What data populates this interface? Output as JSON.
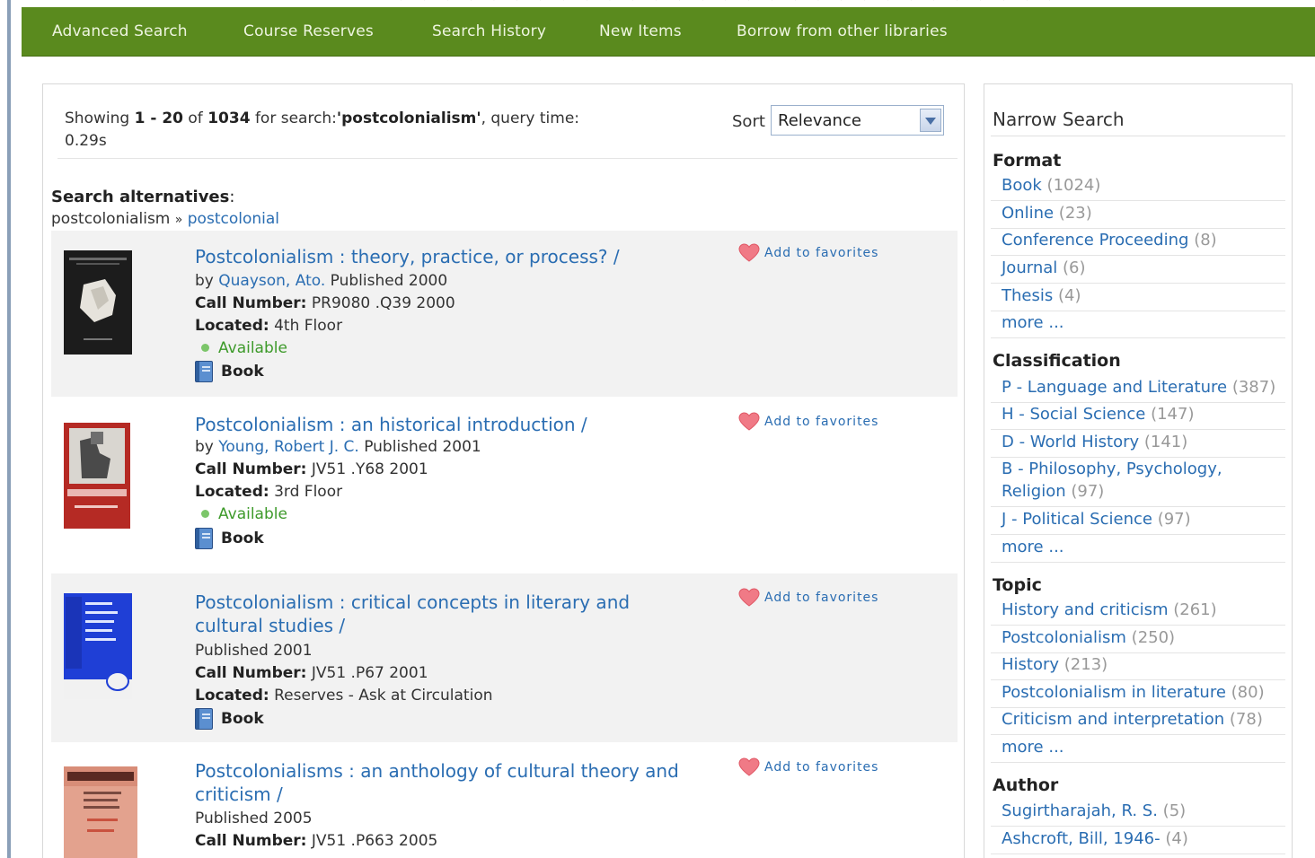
{
  "nav": {
    "items": [
      "Advanced Search",
      "Course Reserves",
      "Search History",
      "New Items",
      "Borrow from other libraries"
    ]
  },
  "header": {
    "showing_label": "Showing",
    "range_start": "1",
    "range_sep": " - ",
    "range_end": "20",
    "of_label": "of",
    "total": "1034",
    "for_search_label": "for search:",
    "query": "'postcolonialism'",
    "query_time_label": ", query time:",
    "query_time": "0.29s"
  },
  "sort": {
    "label": "Sort",
    "selected": "Relevance"
  },
  "alternatives": {
    "title": "Search alternatives",
    "colon": ":",
    "from": "postcolonialism",
    "sep": "»",
    "to": "postcolonial"
  },
  "labels": {
    "by": "by",
    "call_number": "Call Number",
    "located": "Located",
    "colon": ":",
    "add_favorites": "Add to favorites"
  },
  "records": [
    {
      "title": "Postcolonialism : theory, practice, or process? /",
      "author": "Quayson, Ato.",
      "published": "Published 2000",
      "call_number": "PR9080 .Q39 2000",
      "location": "4th Floor",
      "status": "Available",
      "format": "Book"
    },
    {
      "title": "Postcolonialism : an historical introduction /",
      "author": "Young, Robert J. C.",
      "published": "Published 2001",
      "call_number": "JV51 .Y68 2001",
      "location": "3rd Floor",
      "status": "Available",
      "format": "Book"
    },
    {
      "title": "Postcolonialism : critical concepts in literary and cultural studies /",
      "published": "Published 2001",
      "call_number": "JV51 .P67 2001",
      "location": "Reserves - Ask at Circulation",
      "format": "Book"
    },
    {
      "title": "Postcolonialisms : an anthology of cultural theory and criticism /",
      "published": "Published 2005",
      "call_number": "JV51 .P663 2005"
    }
  ],
  "sidebar": {
    "title": "Narrow Search",
    "more_label": "more ...",
    "format": {
      "title": "Format",
      "items": [
        {
          "label": "Book",
          "count": "(1024)"
        },
        {
          "label": "Online",
          "count": "(23)"
        },
        {
          "label": "Conference Proceeding",
          "count": "(8)"
        },
        {
          "label": "Journal",
          "count": "(6)"
        },
        {
          "label": "Thesis",
          "count": "(4)"
        }
      ]
    },
    "classification": {
      "title": "Classification",
      "items": [
        {
          "label": "P - Language and Literature",
          "count": "(387)"
        },
        {
          "label": "H - Social Science",
          "count": "(147)"
        },
        {
          "label": "D - World History",
          "count": "(141)"
        },
        {
          "label": "B - Philosophy, Psychology, Religion",
          "count": "(97)"
        },
        {
          "label": "J - Political Science",
          "count": "(97)"
        }
      ]
    },
    "topic": {
      "title": "Topic",
      "items": [
        {
          "label": "History and criticism",
          "count": "(261)"
        },
        {
          "label": "Postcolonialism",
          "count": "(250)"
        },
        {
          "label": "History",
          "count": "(213)"
        },
        {
          "label": "Postcolonialism in literature",
          "count": "(80)"
        },
        {
          "label": "Criticism and interpretation",
          "count": "(78)"
        }
      ]
    },
    "author": {
      "title": "Author",
      "items": [
        {
          "label": "Sugirtharajah, R. S.",
          "count": "(5)"
        },
        {
          "label": "Ashcroft, Bill, 1946-",
          "count": "(4)"
        }
      ]
    }
  },
  "colors": {
    "nav_bg": "#5a8a1e",
    "link": "#2a6db2",
    "available": "#3d9a2a",
    "count": "#999999"
  }
}
